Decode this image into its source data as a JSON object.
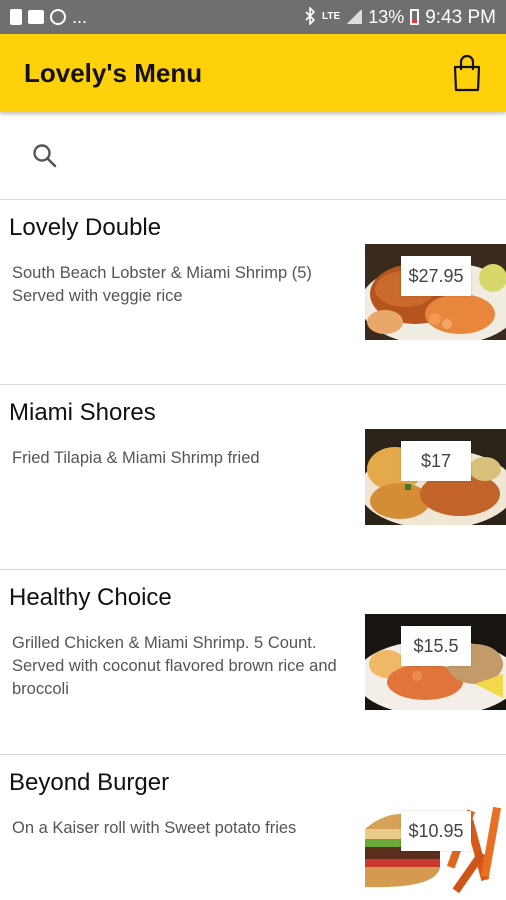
{
  "status_bar": {
    "dots": "...",
    "battery": "13%",
    "time": "9:43 PM",
    "network": "LTE"
  },
  "app_bar": {
    "title": "Lovely's Menu",
    "cart_icon": "shopping-bag-icon"
  },
  "search": {
    "placeholder": "",
    "icon": "search-icon"
  },
  "menu": {
    "items": [
      {
        "title": "Lovely Double",
        "description": "South Beach Lobster & Miami Shrimp (5) Served with veggie rice",
        "price": "$27.95",
        "image": "seafood-platter"
      },
      {
        "title": "Miami Shores",
        "description": "Fried Tilapia & Miami Shrimp fried",
        "price": "$17",
        "image": "fried-fish-platter"
      },
      {
        "title": "Healthy Choice",
        "description": "Grilled Chicken & Miami Shrimp. 5 Count. Served with coconut flavored brown rice and broccoli",
        "price": "$15.5",
        "image": "chicken-shrimp-platter"
      },
      {
        "title": "Beyond Burger",
        "description": "On a Kaiser roll with Sweet potato fries",
        "price": "$10.95",
        "image": "burger-fries"
      }
    ]
  },
  "colors": {
    "app_bar": "#ffd10a",
    "status_bar": "#6f6f6f"
  }
}
